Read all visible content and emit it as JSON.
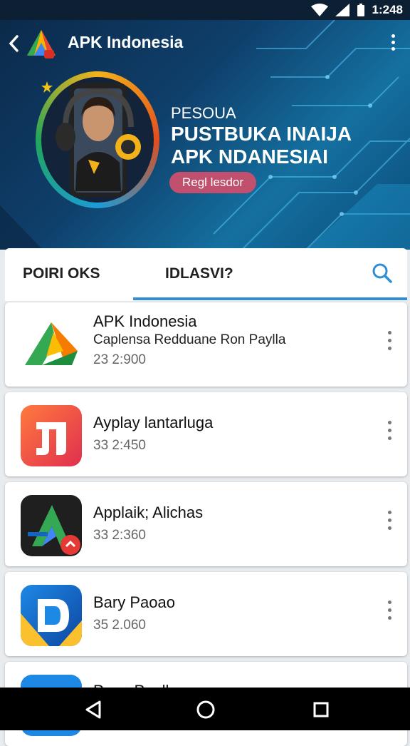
{
  "status_bar": {
    "time": "1:248"
  },
  "app_bar": {
    "title": "APK Indonesia"
  },
  "hero": {
    "subtitle": "PESOUA",
    "title_line1": "PUSTBUKA INAIJA",
    "title_line2": "APK NDANESIAI",
    "button_label": "Regl lesdor"
  },
  "tabs": [
    {
      "label": "POIRI OKS"
    },
    {
      "label": "IDLASVI?"
    }
  ],
  "apps": [
    {
      "title": "APK Indonesia",
      "subtitle": "Caplensa Redduane Ron Paylla",
      "meta": "23 2:900",
      "icon": "apk-indonesia-icon"
    },
    {
      "title": "Ayplay lantarluga",
      "subtitle": "",
      "meta": "33 2:450",
      "icon": "music-app-icon"
    },
    {
      "title": "Applaik; Alichas",
      "subtitle": "",
      "meta": "33 2:360",
      "icon": "green-a-app-icon"
    },
    {
      "title": "Bary Paoao",
      "subtitle": "",
      "meta": "35 2.060",
      "icon": "blue-d-app-icon"
    },
    {
      "title": "Paoo Paull..",
      "subtitle": "",
      "meta": "",
      "icon": "partial-app-icon"
    }
  ],
  "colors": {
    "accent": "#2f8ed4",
    "hero_button": "#c0506d",
    "status_bar": "#0c1f33"
  }
}
